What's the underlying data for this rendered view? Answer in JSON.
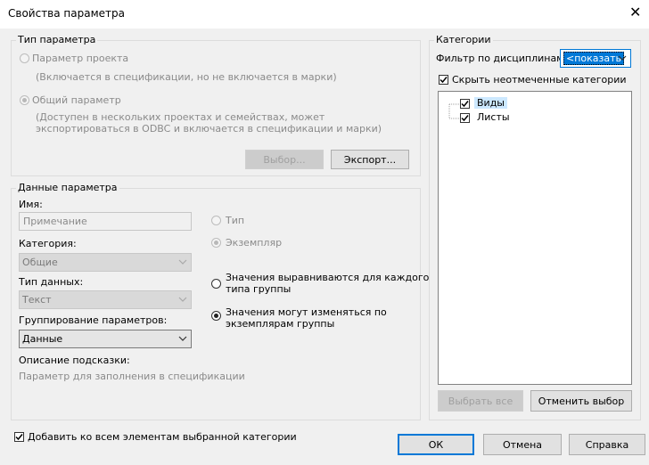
{
  "window": {
    "title": "Свойства параметра",
    "close_glyph": "✕"
  },
  "param_type": {
    "legend": "Тип параметра",
    "project_param": {
      "label": "Параметр проекта",
      "note": "(Включается в спецификации, но не включается в марки)"
    },
    "shared_param": {
      "label": "Общий параметр",
      "note_line1": "(Доступен в нескольких проектах и семействах, может",
      "note_line2": "экспортироваться в ODBC и включается в спецификации и марки)"
    },
    "select_button": "Выбор...",
    "export_button": "Экспорт..."
  },
  "param_data": {
    "legend": "Данные параметра",
    "name_label": "Имя:",
    "name_value": "Примечание",
    "category_label": "Категория:",
    "category_value": "Общие",
    "data_type_label": "Тип данных:",
    "data_type_value": "Текст",
    "grouping_label": "Группирование параметров:",
    "grouping_value": "Данные",
    "tooltip_label": "Описание подсказки:",
    "tooltip_value": "Параметр для заполнения в спецификации",
    "radio_type": "Тип",
    "radio_instance": "Экземпляр",
    "radio_aligned_line1": "Значения выравниваются для каждого",
    "radio_aligned_line2": "типа группы",
    "radio_vary_line1": "Значения могут изменяться по",
    "radio_vary_line2": "экземплярам группы"
  },
  "categories": {
    "legend": "Категории",
    "filter_label": "Фильтр по дисциплинам:",
    "filter_value": "<показать",
    "hide_unchecked": "Скрыть неотмеченные категории",
    "tree_items": [
      "Виды",
      "Листы"
    ],
    "select_all": "Выбрать все",
    "deselect": "Отменить выбор"
  },
  "footer": {
    "add_to_all": "Добавить ко всем элементам выбранной категории",
    "ok": "ОК",
    "cancel": "Отмена",
    "help": "Справка"
  },
  "colors": {
    "accent": "#0078d7",
    "highlight": "#cce8ff",
    "disabled_text": "#8a8a8a"
  }
}
